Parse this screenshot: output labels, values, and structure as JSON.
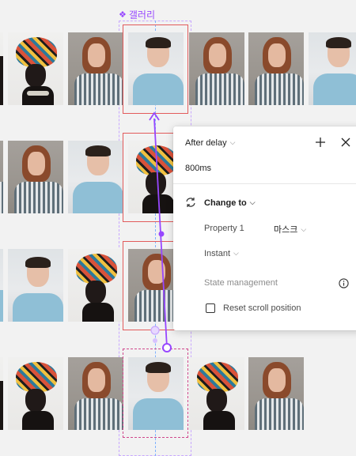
{
  "canvas": {
    "component_label": "갤러리",
    "component_icon": "component-diamond-icon"
  },
  "photos": {
    "row1": [
      "afro-headwrap-woman-photo",
      "afro-headwrap-woman-photo",
      "redhead-woman-photo",
      "smiling-man-photo",
      "redhead-woman-photo",
      "redhead-woman-photo",
      "smiling-man-photo"
    ],
    "row2": [
      "redhead-woman-photo",
      "redhead-woman-photo",
      "smiling-man-photo",
      "afro-headwrap-woman-photo"
    ],
    "row3": [
      "smiling-man-photo",
      "smiling-man-photo",
      "afro-headwrap-woman-photo",
      "redhead-woman-photo"
    ],
    "row4": [
      "afro-headwrap-woman-photo",
      "redhead-woman-photo",
      "smiling-man-photo",
      "afro-headwrap-woman-photo",
      "redhead-woman-photo"
    ]
  },
  "interaction_panel": {
    "trigger_label": "After delay",
    "delay_value": "800ms",
    "action_label": "Change to",
    "property_label": "Property 1",
    "property_value": "마스크",
    "animation_label": "Instant",
    "state_management_label": "State management",
    "reset_scroll_label": "Reset scroll position",
    "reset_scroll_checked": false
  },
  "colors": {
    "prototype_purple": "#9747ff",
    "selection_red": "#e25b5b",
    "panel_bg": "#ffffff",
    "canvas_bg": "#f2f2f2"
  }
}
